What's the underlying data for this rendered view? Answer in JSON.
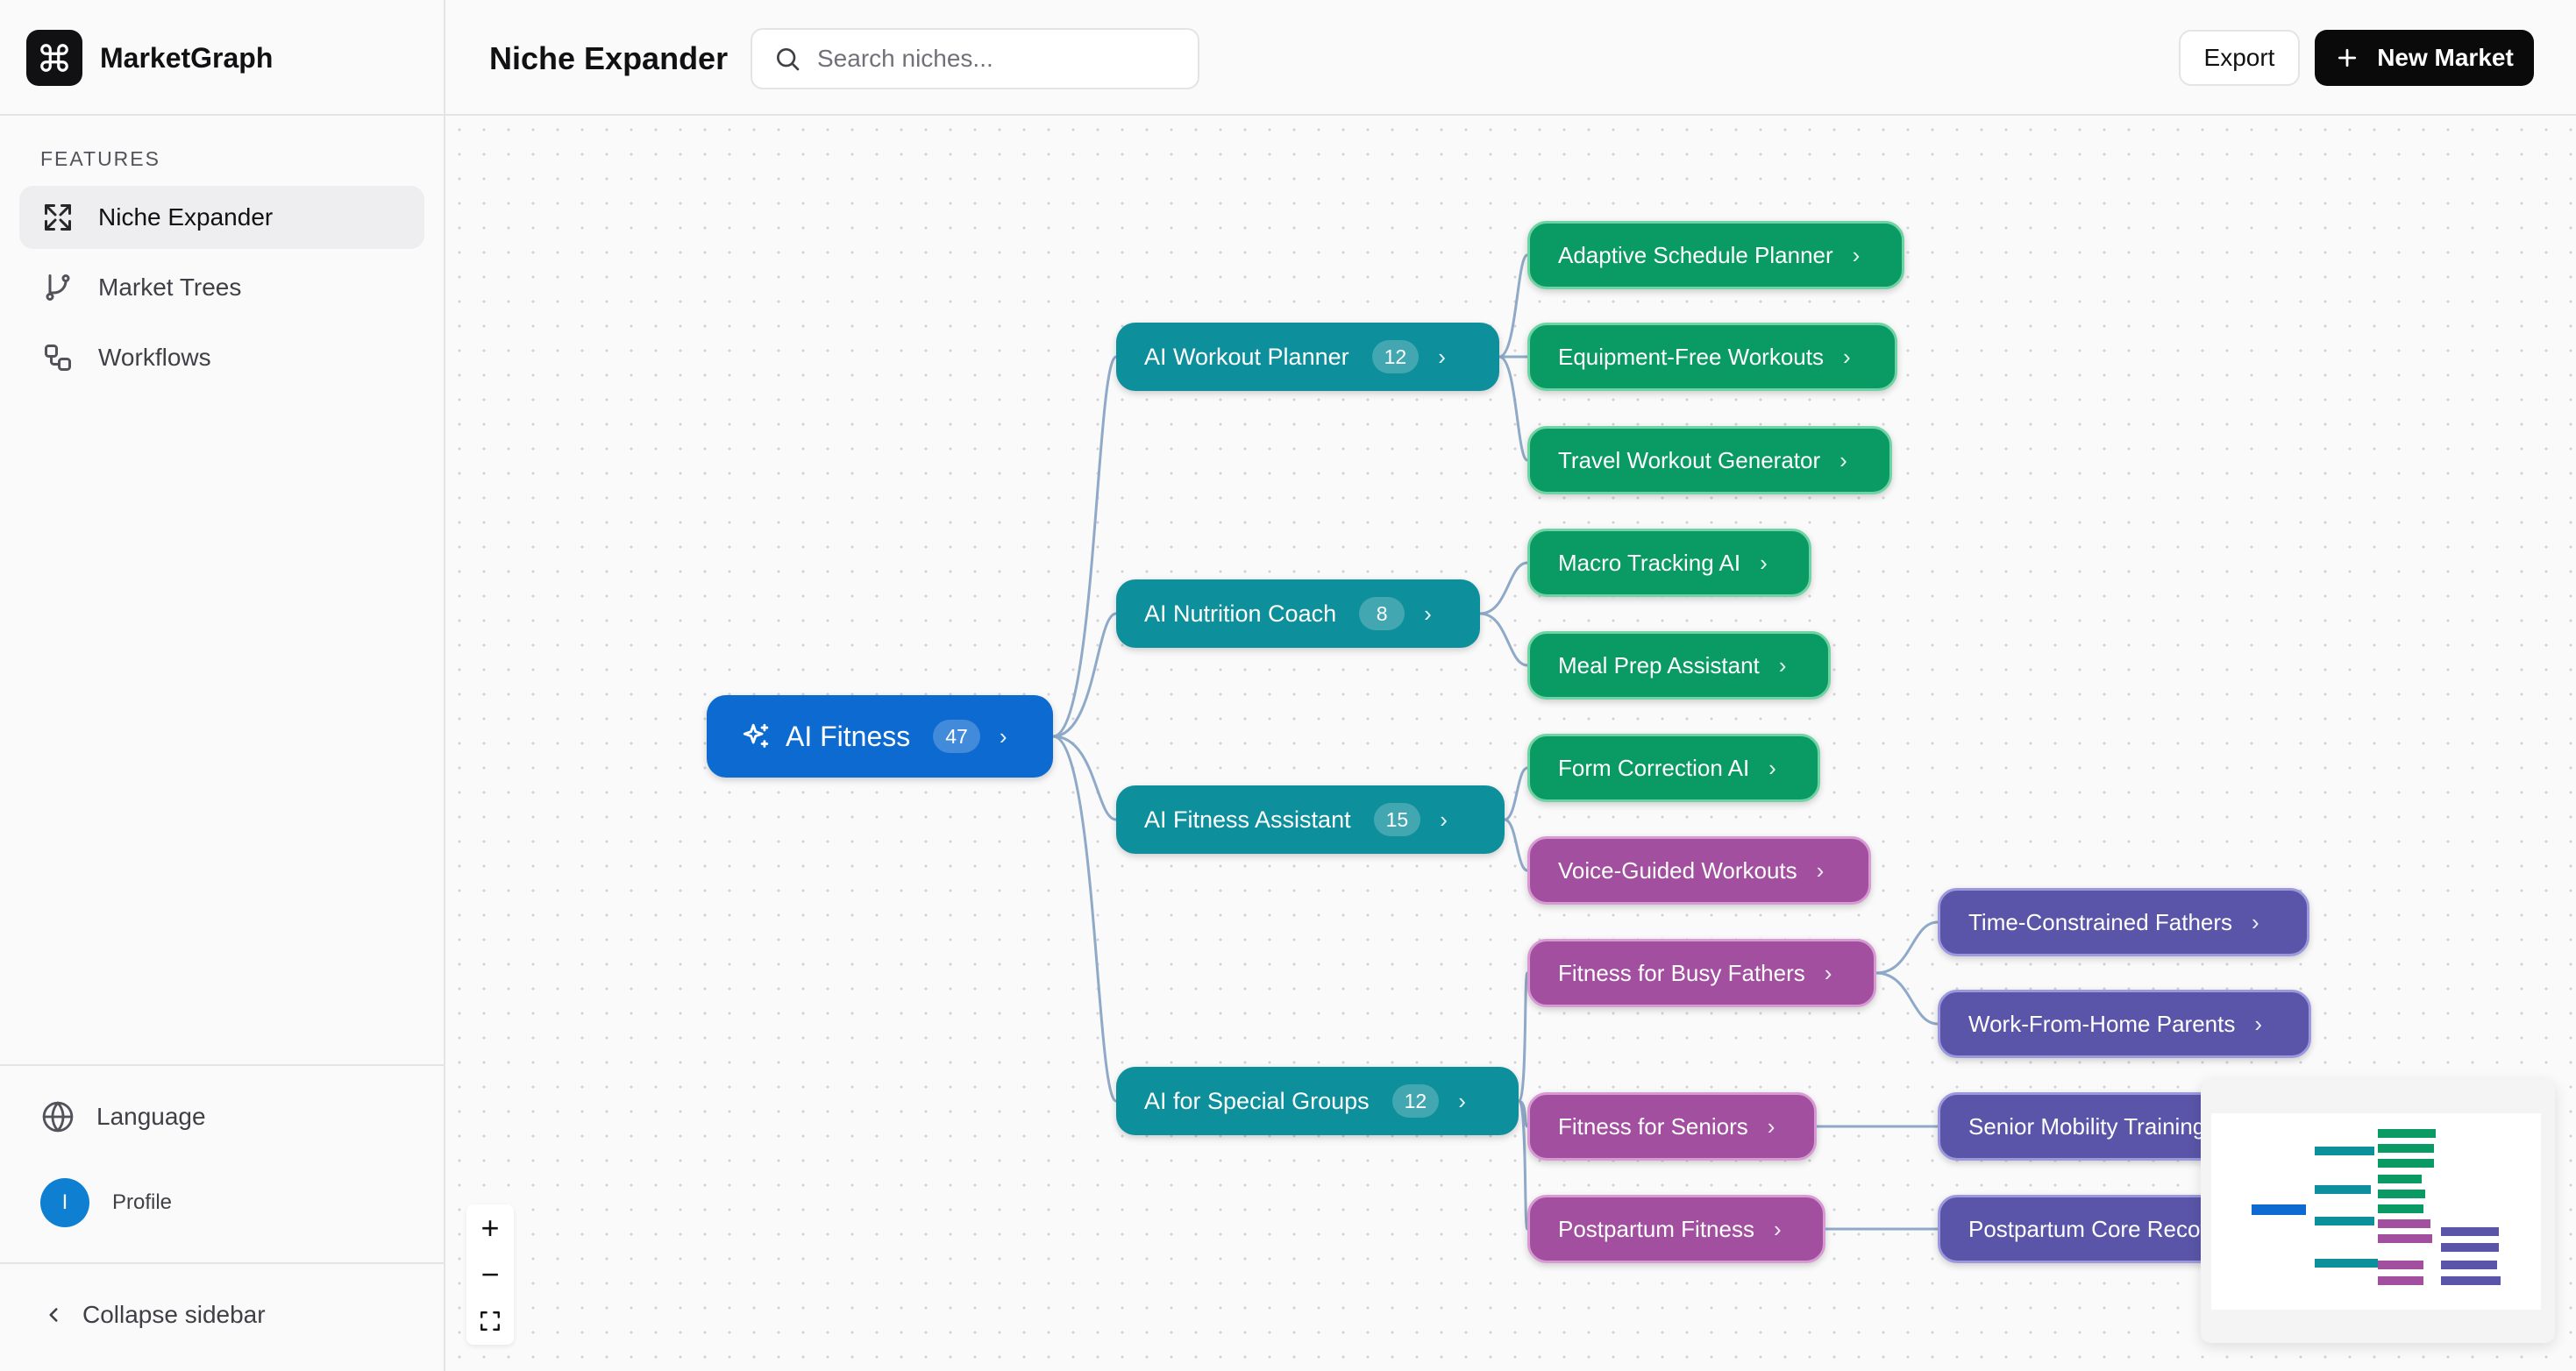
{
  "app": {
    "name": "MarketGraph",
    "logo_icon": "command-icon"
  },
  "sidebar": {
    "section_label": "FEATURES",
    "items": [
      {
        "label": "Niche Expander",
        "icon": "expand-icon",
        "active": true
      },
      {
        "label": "Market Trees",
        "icon": "git-branch-icon",
        "active": false
      },
      {
        "label": "Workflows",
        "icon": "workflow-icon",
        "active": false
      }
    ],
    "language_label": "Language",
    "profile": {
      "initial": "I",
      "label": "Profile"
    },
    "collapse_label": "Collapse sidebar"
  },
  "header": {
    "title": "Niche Expander",
    "search_placeholder": "Search niches...",
    "export_label": "Export",
    "new_market_label": "New Market"
  },
  "tree": {
    "root": {
      "label": "AI Fitness",
      "count": "47"
    },
    "branches": [
      {
        "label": "AI Workout Planner",
        "count": "12"
      },
      {
        "label": "AI Nutrition Coach",
        "count": "8"
      },
      {
        "label": "AI Fitness Assistant",
        "count": "15"
      },
      {
        "label": "AI for Special Groups",
        "count": "12"
      }
    ],
    "leaves": [
      {
        "label": "Adaptive Schedule Planner"
      },
      {
        "label": "Equipment-Free Workouts"
      },
      {
        "label": "Travel Workout Generator"
      },
      {
        "label": "Macro Tracking AI"
      },
      {
        "label": "Meal Prep Assistant"
      },
      {
        "label": "Form Correction AI"
      },
      {
        "label": "Voice-Guided Workouts"
      },
      {
        "label": "Fitness for Busy Fathers"
      },
      {
        "label": "Fitness for Seniors"
      },
      {
        "label": "Postpartum Fitness"
      }
    ],
    "subleaves": [
      {
        "label": "Time-Constrained Fathers"
      },
      {
        "label": "Work-From-Home Parents"
      },
      {
        "label": "Senior Mobility Training"
      },
      {
        "label": "Postpartum Core Recovery"
      }
    ]
  },
  "zoom_controls": {
    "zoom_in": "+",
    "zoom_out": "−"
  },
  "colors": {
    "root": "#0d6ad0",
    "branch": "#0e8f9c",
    "leaf_green": "#0a9a63",
    "leaf_purple": "#a14f9e",
    "subleaf_indigo": "#5a55a8",
    "edge": "#8fa9c8"
  }
}
